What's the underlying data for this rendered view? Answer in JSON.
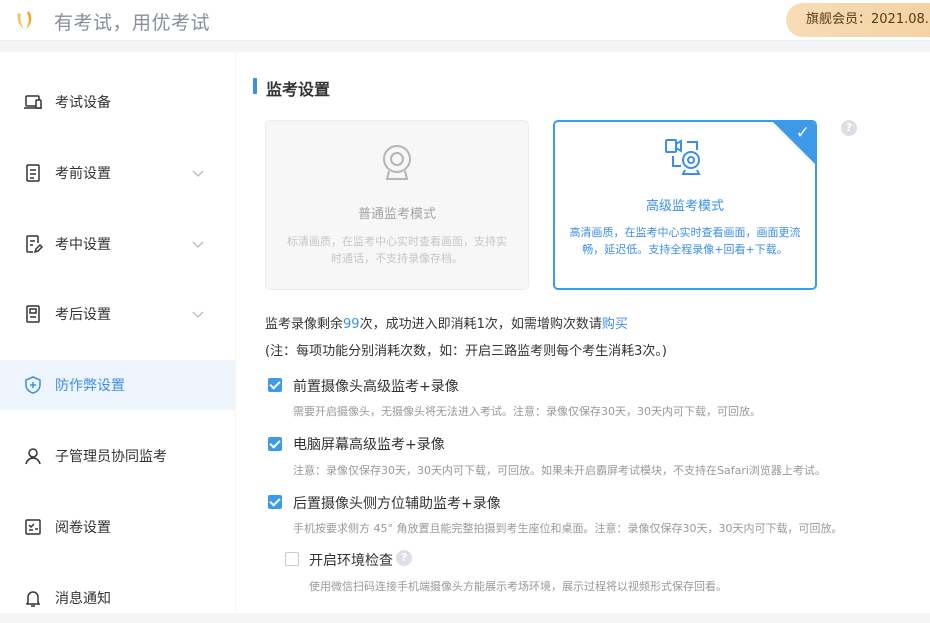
{
  "header": {
    "slogan": "有考试，用优考试",
    "member_badge": "旗舰会员：2021.08.",
    "colors": {
      "brand": "#f5a623",
      "badge_bg": "#f5d9ae"
    }
  },
  "sidebar": {
    "items": [
      {
        "label": "考试设备",
        "icon": "laptop-icon",
        "has_chevron": false,
        "active": false
      },
      {
        "label": "考前设置",
        "icon": "document-list-icon",
        "has_chevron": true,
        "active": false
      },
      {
        "label": "考中设置",
        "icon": "edit-document-icon",
        "has_chevron": true,
        "active": false
      },
      {
        "label": "考后设置",
        "icon": "score-document-icon",
        "has_chevron": true,
        "active": false
      },
      {
        "label": "防作弊设置",
        "icon": "shield-plus-icon",
        "has_chevron": false,
        "active": true
      },
      {
        "label": "子管理员协同监考",
        "icon": "user-icon",
        "has_chevron": false,
        "active": false
      },
      {
        "label": "阅卷设置",
        "icon": "checklist-icon",
        "has_chevron": false,
        "active": false
      },
      {
        "label": "消息通知",
        "icon": "bell-icon",
        "has_chevron": false,
        "active": false
      }
    ]
  },
  "main": {
    "section_title": "监考设置",
    "modes": {
      "normal": {
        "title": "普通监考模式",
        "desc": "标清画质，在监考中心实时查看画面，支持实时通话，不支持录像存档。",
        "selected": false
      },
      "advanced": {
        "title": "高级监考模式",
        "desc": "高清画质，在监考中心实时查看画面，画面更流畅，延迟低。支持全程录像+回看+下载。",
        "selected": true,
        "check": "✓"
      }
    },
    "help_mark": "?",
    "quota": {
      "prefix": "监考录像剩余",
      "count": "99",
      "middle": "次，成功进入即消耗1次，如需增购次数请",
      "buy_link": "购买"
    },
    "note": "(注：每项功能分别消耗次数，如：开启三路监考则每个考生消耗3次。)",
    "options": [
      {
        "label": "前置摄像头高级监考+录像",
        "checked": true,
        "desc": "需要开启摄像头，无摄像头将无法进入考试。注意：录像仅保存30天，30天内可下载，可回放。"
      },
      {
        "label": "电脑屏幕高级监考+录像",
        "checked": true,
        "desc": "注意：录像仅保存30天，30天内可下载，可回放。如果未开启霸屏考试模块，不支持在Safari浏览器上考试。"
      },
      {
        "label": "后置摄像头侧方位辅助监考+录像",
        "checked": true,
        "desc": "手机按要求侧方 45° 角放置且能完整拍摄到考生座位和桌面。注意：录像仅保存30天，30天内可下载，可回放。"
      }
    ],
    "sub_option": {
      "label": "开启环境检查",
      "checked": false,
      "desc": "使用微信扫码连接手机端摄像头方能展示考场环境，展示过程将以视频形式保存回看。"
    },
    "accent_color": "#3d8fe5"
  }
}
